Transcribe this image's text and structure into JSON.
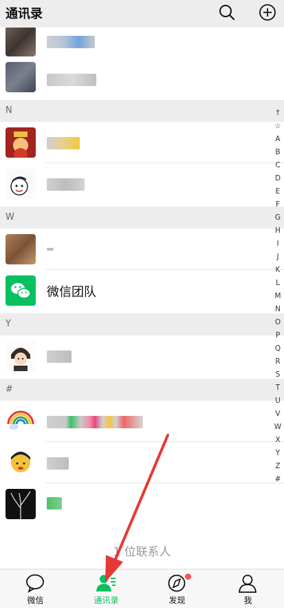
{
  "header": {
    "title": "通讯录",
    "search_icon": "search-icon",
    "add_icon": "add-circle-icon"
  },
  "sections": [
    "N",
    "W",
    "Y",
    "#"
  ],
  "contacts": {
    "wechat_team": "微信团队"
  },
  "index_bar": [
    "↑",
    "☆",
    "A",
    "B",
    "C",
    "D",
    "E",
    "F",
    "G",
    "H",
    "I",
    "J",
    "K",
    "L",
    "M",
    "N",
    "O",
    "P",
    "Q",
    "R",
    "S",
    "T",
    "U",
    "V",
    "W",
    "X",
    "Y",
    "Z",
    "#"
  ],
  "footer": {
    "count_text": "1 位联系人"
  },
  "tabs": [
    {
      "label": "微信",
      "icon": "chat-bubble-icon"
    },
    {
      "label": "通讯录",
      "icon": "contacts-icon"
    },
    {
      "label": "发现",
      "icon": "compass-icon"
    },
    {
      "label": "我",
      "icon": "person-icon"
    }
  ],
  "colors": {
    "accent": "#07c160",
    "badge": "#fa5151",
    "arrow": "#e53935"
  }
}
